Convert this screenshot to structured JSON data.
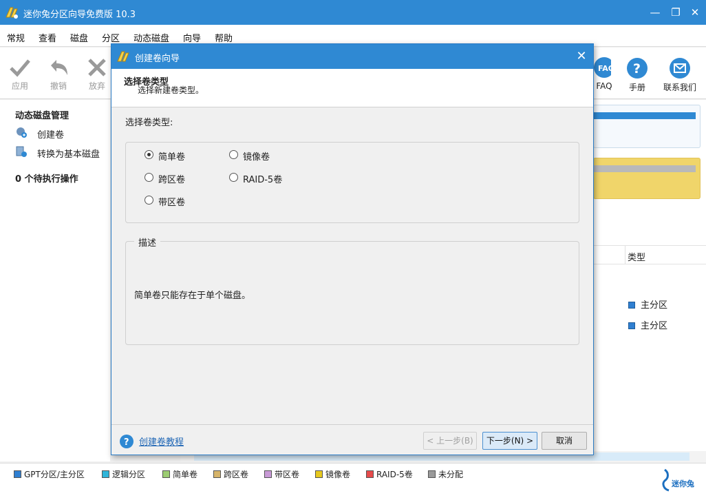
{
  "window": {
    "title": "迷你兔分区向导免费版 10.3"
  },
  "menu": [
    "常规",
    "查看",
    "磁盘",
    "分区",
    "动态磁盘",
    "向导",
    "帮助"
  ],
  "toolbar": {
    "apply": "应用",
    "undo": "撤销",
    "discard": "放弃",
    "faq": "FAQ",
    "manual": "手册",
    "contact": "联系我们"
  },
  "sidebar": {
    "section_title": "动态磁盘管理",
    "ops": [
      "创建卷",
      "转换为基本磁盘"
    ],
    "pending": "0 个待执行操作"
  },
  "main": {
    "type_column": "类型",
    "partition_types": [
      "主分区",
      "主分区"
    ]
  },
  "legend": [
    {
      "label": "GPT分区/主分区",
      "color": "#2f7fd1"
    },
    {
      "label": "逻辑分区",
      "color": "#2fb5d9"
    },
    {
      "label": "简单卷",
      "color": "#9ccc72"
    },
    {
      "label": "跨区卷",
      "color": "#d6b46a"
    },
    {
      "label": "带区卷",
      "color": "#c89ad6"
    },
    {
      "label": "镜像卷",
      "color": "#e6c81e"
    },
    {
      "label": "RAID-5卷",
      "color": "#e64b4b"
    },
    {
      "label": "未分配",
      "color": "#9a9a9a"
    }
  ],
  "brand": {
    "name": "迷你兔"
  },
  "dialog": {
    "title": "创建卷向导",
    "header_title": "选择卷类型",
    "header_subtitle": "选择新建卷类型。",
    "section_label": "选择卷类型:",
    "options": {
      "simple": "简单卷",
      "mirror": "镜像卷",
      "spanned": "跨区卷",
      "raid5": "RAID-5卷",
      "striped": "带区卷"
    },
    "selected": "简单卷",
    "desc_title": "描述",
    "desc_text": "简单卷只能存在于单个磁盘。",
    "tutorial_link": "创建卷教程",
    "buttons": {
      "back": "< 上一步(B)",
      "next": "下一步(N) >",
      "cancel": "取消"
    }
  },
  "colors": {
    "accent": "#2f89d3",
    "disk_bar": "#2f89d3",
    "mirror_fill": "#f0d56a"
  }
}
